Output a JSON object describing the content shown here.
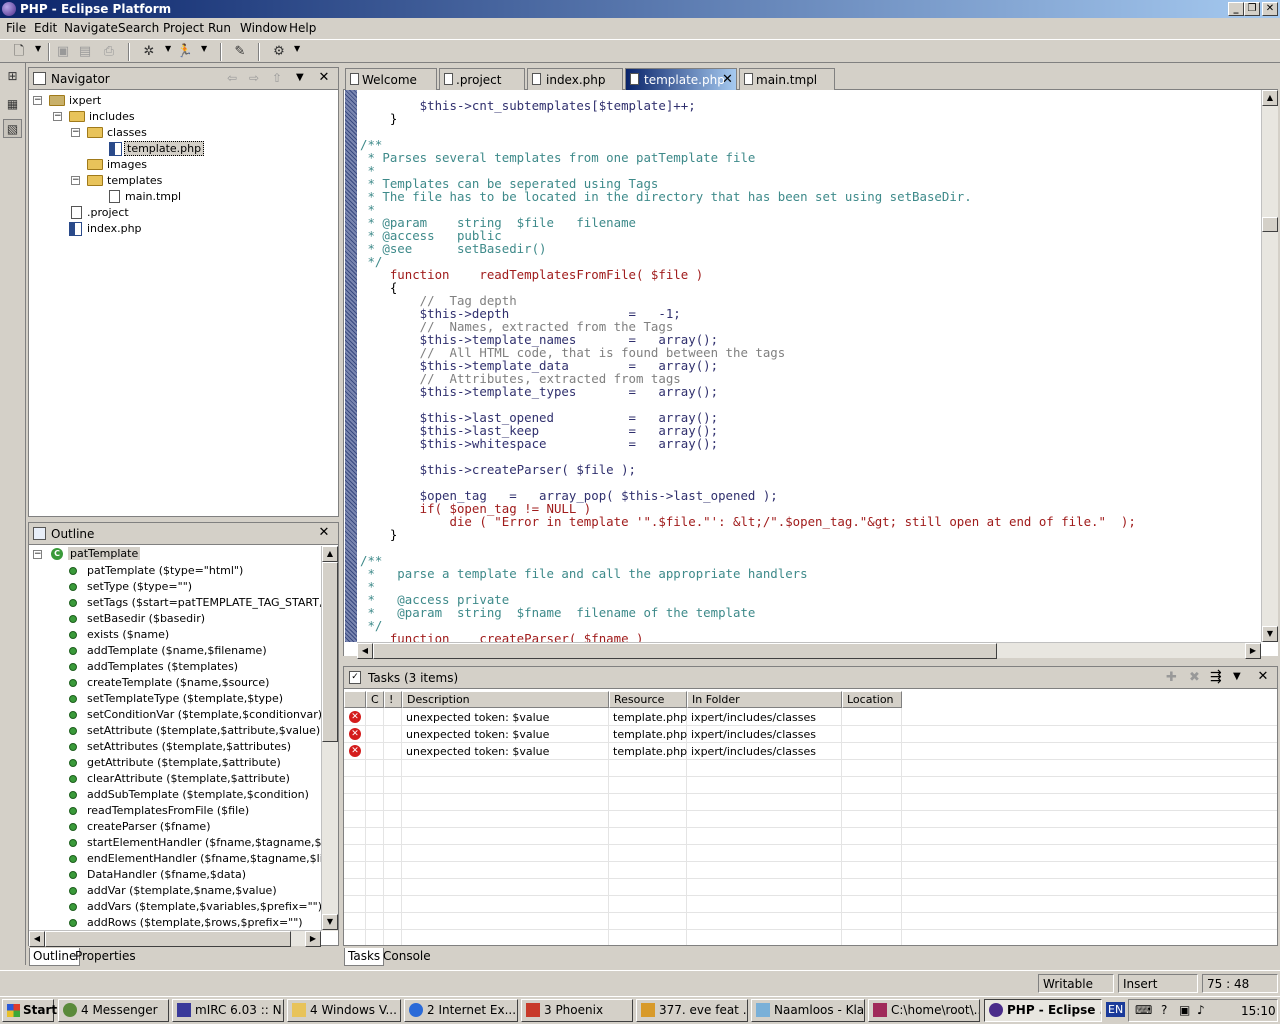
{
  "window": {
    "title": "PHP - Eclipse Platform"
  },
  "menu": [
    "File",
    "Edit",
    "Navigate",
    "Search",
    "Project",
    "Run",
    "Window",
    "Help"
  ],
  "navigator": {
    "title": "Navigator",
    "tree": [
      {
        "label": "ixpert",
        "type": "project"
      },
      {
        "label": "includes",
        "type": "folder"
      },
      {
        "label": "classes",
        "type": "folder"
      },
      {
        "label": "template.php",
        "type": "php"
      },
      {
        "label": "images",
        "type": "folder"
      },
      {
        "label": "templates",
        "type": "folder"
      },
      {
        "label": "main.tmpl",
        "type": "file"
      },
      {
        "label": ".project",
        "type": "file"
      },
      {
        "label": "index.php",
        "type": "php"
      }
    ]
  },
  "outline": {
    "title": "Outline",
    "root": "patTemplate",
    "items": [
      "patTemplate ($type=\"html\")",
      "setType ($type=\"\")",
      "setTags ($start=patTEMPLATE_TAG_START,$en",
      "setBasedir ($basedir)",
      "exists ($name)",
      "addTemplate ($name,$filename)",
      "addTemplates ($templates)",
      "createTemplate ($name,$source)",
      "setTemplateType ($template,$type)",
      "setConditionVar ($template,$conditionvar)",
      "setAttribute ($template,$attribute,$value)",
      "setAttributes ($template,$attributes)",
      "getAttribute ($template,$attribute)",
      "clearAttribute ($template,$attribute)",
      "addSubTemplate ($template,$condition)",
      "readTemplatesFromFile ($file)",
      "createParser ($fname)",
      "startElementHandler ($fname,$tagname,$attribu",
      "endElementHandler ($fname,$tagname,$line)",
      "DataHandler ($fname,$data)",
      "addVar ($template,$name,$value)",
      "addVars ($template,$variables,$prefix=\"\")",
      "addRows ($template,$rows,$prefix=\"\")"
    ],
    "tabs": [
      "Outline",
      "Properties"
    ]
  },
  "editor": {
    "tabs": [
      "Welcome",
      ".project",
      "index.php",
      "template.php",
      "main.tmpl"
    ],
    "active_tab": "template.php",
    "lines": [
      {
        "t": "        $this->cnt_subtemplates[$template]++;",
        "c": "var"
      },
      {
        "t": "    }",
        "c": ""
      },
      {
        "t": "",
        "c": ""
      },
      {
        "t": "/**",
        "c": "comment"
      },
      {
        "t": " * Parses several templates from one patTemplate file",
        "c": "comment"
      },
      {
        "t": " *",
        "c": "comment"
      },
      {
        "t": " * Templates can be seperated using Tags",
        "c": "comment"
      },
      {
        "t": " * The file has to be located in the directory that has been set using setBaseDir.",
        "c": "comment"
      },
      {
        "t": " *",
        "c": "comment"
      },
      {
        "t": " * @param    string  $file   filename",
        "c": "comment"
      },
      {
        "t": " * @access   public",
        "c": "comment"
      },
      {
        "t": " * @see      setBasedir()",
        "c": "comment"
      },
      {
        "t": " */",
        "c": "comment"
      },
      {
        "t": "    function    readTemplatesFromFile( $file )",
        "c": "func"
      },
      {
        "t": "    {",
        "c": ""
      },
      {
        "t": "        //  Tag depth",
        "c": "grey"
      },
      {
        "t": "        $this->depth                =   -1;",
        "c": "var"
      },
      {
        "t": "        //  Names, extracted from the Tags",
        "c": "grey"
      },
      {
        "t": "        $this->template_names       =   array();",
        "c": "arr"
      },
      {
        "t": "        //  All HTML code, that is found between the tags",
        "c": "grey"
      },
      {
        "t": "        $this->template_data        =   array();",
        "c": "arr"
      },
      {
        "t": "        //  Attributes, extracted from tags",
        "c": "grey"
      },
      {
        "t": "        $this->template_types       =   array();",
        "c": "arr"
      },
      {
        "t": "",
        "c": ""
      },
      {
        "t": "        $this->last_opened          =   array();",
        "c": "arr"
      },
      {
        "t": "        $this->last_keep            =   array();",
        "c": "arr"
      },
      {
        "t": "        $this->whitespace           =   array();",
        "c": "arr"
      },
      {
        "t": "",
        "c": ""
      },
      {
        "t": "        $this->createParser( $file );",
        "c": "var"
      },
      {
        "t": "",
        "c": ""
      },
      {
        "t": "        $open_tag   =   array_pop( $this->last_opened );",
        "c": "var"
      },
      {
        "t": "        if( $open_tag != NULL )",
        "c": "if"
      },
      {
        "t": "            die ( \"Error in template '\".$file.\"': &lt;/\".$open_tag.\"&gt; still open at end of file.\"  );",
        "c": "die"
      },
      {
        "t": "    }",
        "c": ""
      },
      {
        "t": "",
        "c": ""
      },
      {
        "t": "/**",
        "c": "comment"
      },
      {
        "t": " *   parse a template file and call the appropriate handlers",
        "c": "comment"
      },
      {
        "t": " *",
        "c": "comment"
      },
      {
        "t": " *   @access private",
        "c": "comment"
      },
      {
        "t": " *   @param  string  $fname  filename of the template",
        "c": "comment"
      },
      {
        "t": " */",
        "c": "comment"
      },
      {
        "t": "    function    createParser( $fname )",
        "c": "func"
      }
    ]
  },
  "tasks": {
    "title": "Tasks (3 items)",
    "columns": [
      "C",
      "!",
      "Description",
      "Resource",
      "In Folder",
      "Location"
    ],
    "rows": [
      {
        "description": "unexpected token: $value",
        "resource": "template.php",
        "folder": "ixpert/includes/classes",
        "location": ""
      },
      {
        "description": "unexpected token: $value",
        "resource": "template.php",
        "folder": "ixpert/includes/classes",
        "location": ""
      },
      {
        "description": "unexpected token: $value",
        "resource": "template.php",
        "folder": "ixpert/includes/classes",
        "location": ""
      }
    ],
    "tabs": [
      "Tasks",
      "Console"
    ]
  },
  "status": {
    "mode": "Writable",
    "insert": "Insert",
    "position": "75 : 48"
  },
  "taskbar": {
    "start": "Start",
    "buttons": [
      "4 Messenger",
      "mIRC 6.03 :: N...",
      "4 Windows V...",
      "2 Internet Ex...",
      "3 Phoenix",
      "377. eve feat ...",
      "Naamloos - Kla...",
      "C:\\home\\root\\...",
      "PHP - Eclipse ..."
    ],
    "lang": "EN",
    "clock": "15:10"
  },
  "colors": {
    "title_start": "#0a246a",
    "title_end": "#a6caf0",
    "comment": "#3e8a8a",
    "keyword": "#a01c1c",
    "error": "#d41c1c"
  }
}
